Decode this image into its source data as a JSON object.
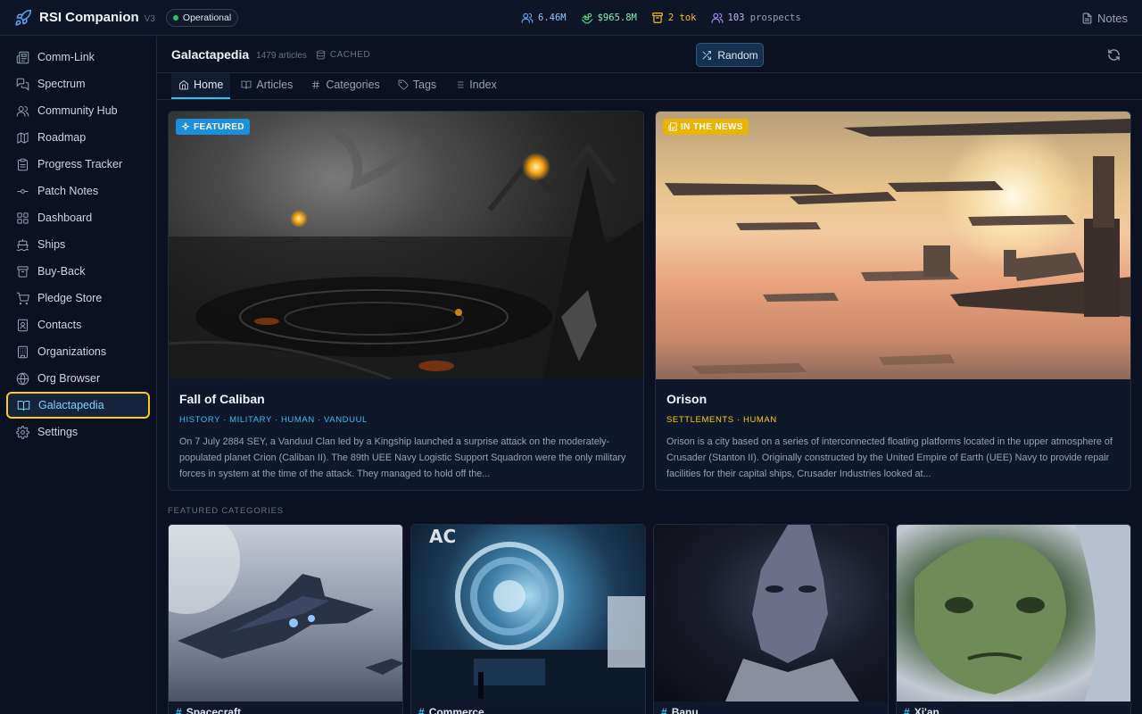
{
  "app": {
    "name": "RSI Companion",
    "version": "V3",
    "status": "Operational"
  },
  "stats": {
    "users": "6.46M",
    "funding": "$965.8M",
    "tok_value": "2",
    "tok_label": "tok",
    "prospects_value": "103",
    "prospects_label": "prospects"
  },
  "notes_label": "Notes",
  "sidebar": {
    "items": [
      {
        "label": "Comm-Link",
        "icon": "newspaper-icon"
      },
      {
        "label": "Spectrum",
        "icon": "chat-icon"
      },
      {
        "label": "Community Hub",
        "icon": "users-icon"
      },
      {
        "label": "Roadmap",
        "icon": "map-icon"
      },
      {
        "label": "Progress Tracker",
        "icon": "clipboard-icon"
      },
      {
        "label": "Patch Notes",
        "icon": "commit-icon"
      },
      {
        "label": "Dashboard",
        "icon": "grid-icon"
      },
      {
        "label": "Ships",
        "icon": "ship-icon"
      },
      {
        "label": "Buy-Back",
        "icon": "archive-icon"
      },
      {
        "label": "Pledge Store",
        "icon": "cart-icon"
      },
      {
        "label": "Contacts",
        "icon": "contact-icon"
      },
      {
        "label": "Organizations",
        "icon": "building-icon"
      },
      {
        "label": "Org Browser",
        "icon": "globe-icon"
      },
      {
        "label": "Galactapedia",
        "icon": "book-icon",
        "active": true
      },
      {
        "label": "Settings",
        "icon": "gear-icon"
      }
    ]
  },
  "header": {
    "title": "Galactapedia",
    "count": "1479 articles",
    "cached": "CACHED",
    "random_label": "Random"
  },
  "tabs": [
    {
      "label": "Home",
      "icon": "home-icon",
      "active": true
    },
    {
      "label": "Articles",
      "icon": "book-icon"
    },
    {
      "label": "Categories",
      "icon": "hash-icon"
    },
    {
      "label": "Tags",
      "icon": "tag-icon"
    },
    {
      "label": "Index",
      "icon": "list-icon"
    }
  ],
  "featured": {
    "badge": "FEATURED",
    "title": "Fall of Caliban",
    "tags": "HISTORY · MILITARY · HUMAN · VANDUUL",
    "description": "On 7 July 2884 SEY, a Vanduul Clan led by a Kingship launched a surprise attack on the moderately-populated planet Crion (Caliban II). The 89th UEE Navy Logistic Support Squadron were the only military forces in system at the time of the attack. They managed to hold off the..."
  },
  "news": {
    "badge": "IN THE NEWS",
    "title": "Orison",
    "tags": "SETTLEMENTS · HUMAN",
    "description": "Orison is a city based on a series of interconnected floating platforms located in the upper atmosphere of Crusader (Stanton II). Originally constructed by the United Empire of Earth (UEE) Navy to provide repair facilities for their capital ships, Crusader Industries looked at..."
  },
  "featured_categories_label": "FEATURED CATEGORIES",
  "categories": [
    {
      "label": "Spacecraft"
    },
    {
      "label": "Commerce"
    },
    {
      "label": "Banu"
    },
    {
      "label": "Xi'an"
    }
  ],
  "colors": {
    "accent": "#38bdf8",
    "highlight": "#facc15",
    "status_ok": "#22c55e"
  }
}
